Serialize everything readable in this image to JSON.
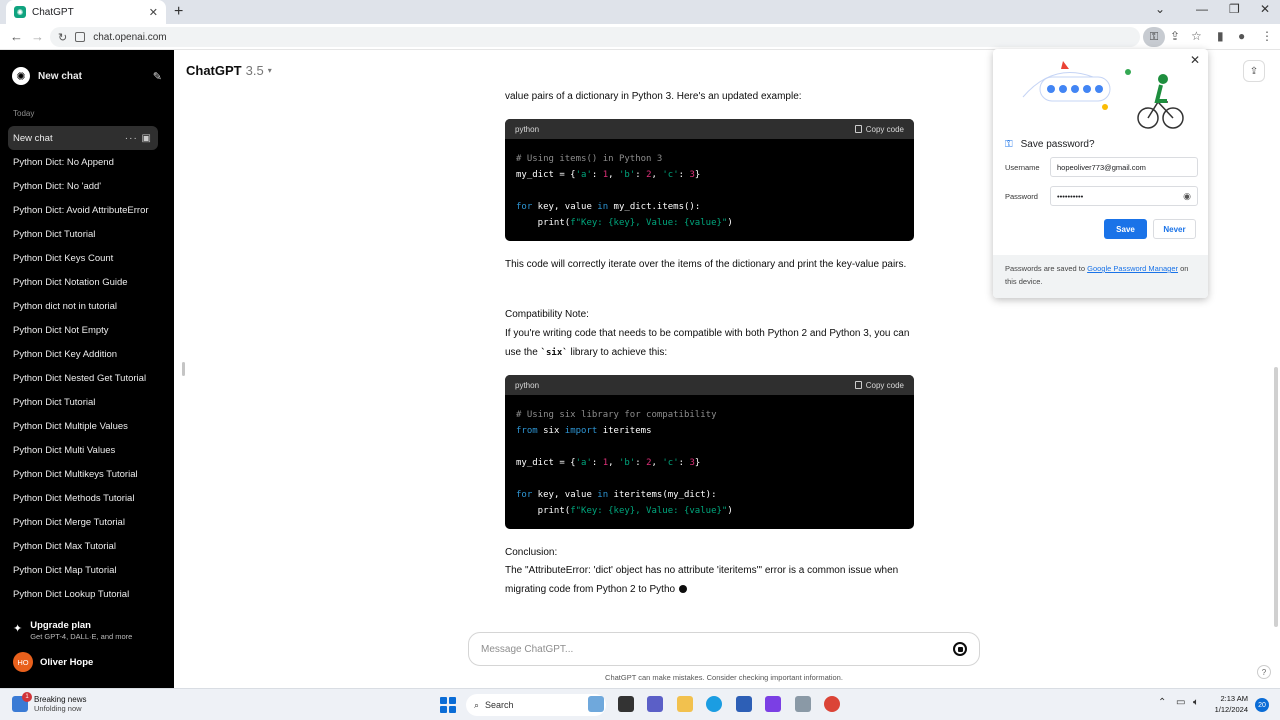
{
  "browser": {
    "tab_title": "ChatGPT",
    "url": "chat.openai.com"
  },
  "sidebar": {
    "new_chat": "New chat",
    "section": "Today",
    "items": [
      {
        "label": "New chat",
        "active": true
      },
      {
        "label": "Python Dict: No Append"
      },
      {
        "label": "Python Dict: No 'add'"
      },
      {
        "label": "Python Dict: Avoid AttributeError"
      },
      {
        "label": "Python Dict Tutorial"
      },
      {
        "label": "Python Dict Keys Count"
      },
      {
        "label": "Python Dict Notation Guide"
      },
      {
        "label": "Python dict not in tutorial"
      },
      {
        "label": "Python Dict Not Empty"
      },
      {
        "label": "Python Dict Key Addition"
      },
      {
        "label": "Python Dict Nested Get Tutorial"
      },
      {
        "label": "Python Dict Tutorial"
      },
      {
        "label": "Python Dict Multiple Values"
      },
      {
        "label": "Python Dict Multi Values"
      },
      {
        "label": "Python Dict Multikeys Tutorial"
      },
      {
        "label": "Python Dict Methods Tutorial"
      },
      {
        "label": "Python Dict Merge Tutorial"
      },
      {
        "label": "Python Dict Max Tutorial"
      },
      {
        "label": "Python Dict Map Tutorial"
      },
      {
        "label": "Python Dict Lookup Tutorial"
      }
    ],
    "upgrade_title": "Upgrade plan",
    "upgrade_sub": "Get GPT-4, DALL·E, and more",
    "user_initials": "HO",
    "user_name": "Oliver Hope"
  },
  "header": {
    "model": "ChatGPT",
    "version": "3.5"
  },
  "conversation": {
    "p1": "value pairs of a dictionary in Python 3. Here's an updated example:",
    "code_lang": "python",
    "copy_label": "Copy code",
    "p2": "This code will correctly iterate over the items of the dictionary and print the key-value pairs.",
    "p3_title": "Compatibility Note:",
    "p3_a": "If you're writing code that needs to be compatible with both Python 2 and Python 3, you can use the ",
    "p3_code": "`six`",
    "p3_b": " library to achieve this:",
    "p4_title": "Conclusion:",
    "p4": "The \"AttributeError: 'dict' object has no attribute 'iteritems'\" error is a common issue when migrating code from Python 2 to Pytho"
  },
  "composer": {
    "placeholder": "Message ChatGPT...",
    "disclaimer": "ChatGPT can make mistakes. Consider checking important information."
  },
  "password_popup": {
    "title": "Save password?",
    "username_label": "Username",
    "username": "hopeoliver773@gmail.com",
    "password_label": "Password",
    "password_mask": "••••••••••",
    "save": "Save",
    "never": "Never",
    "footer_a": "Passwords are saved to ",
    "footer_link": "Google Password Manager",
    "footer_b": " on this device."
  },
  "taskbar": {
    "news_title": "Breaking news",
    "news_sub": "Unfolding now",
    "news_badge": "1",
    "search": "Search",
    "time": "2:13 AM",
    "date": "1/12/2024",
    "notif_count": "20"
  },
  "colors": {
    "accent": "#1a73e8",
    "sidebar_bg": "#000000",
    "code_keyword": "#2e95d3",
    "code_string": "#00a67d",
    "code_number": "#df3079"
  }
}
